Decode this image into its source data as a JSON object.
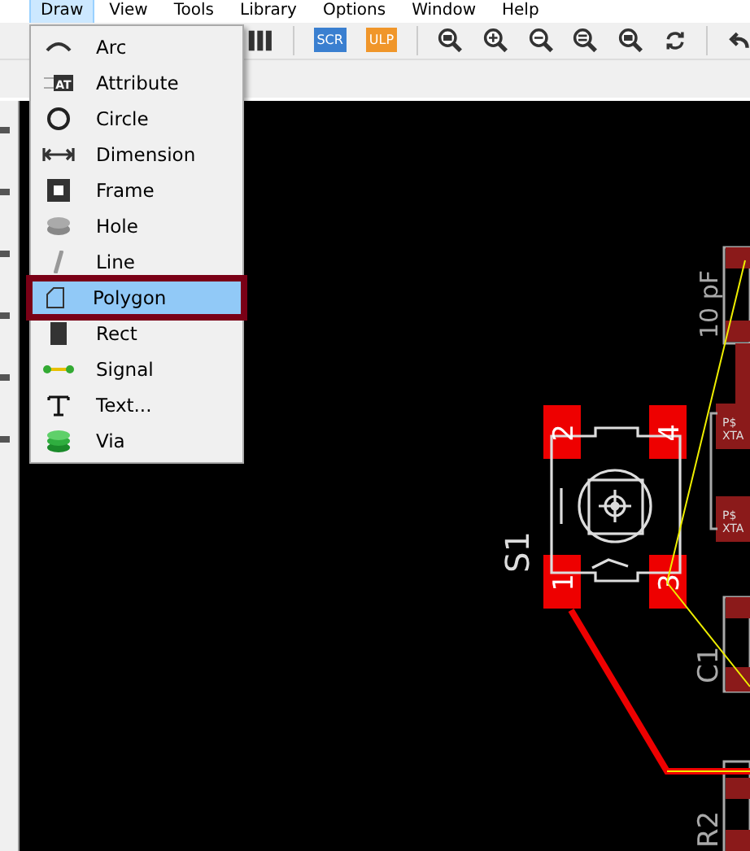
{
  "menubar": [
    {
      "label": "Draw",
      "selected": true
    },
    {
      "label": "View",
      "selected": false
    },
    {
      "label": "Tools",
      "selected": false
    },
    {
      "label": "Library",
      "selected": false
    },
    {
      "label": "Options",
      "selected": false
    },
    {
      "label": "Window",
      "selected": false
    },
    {
      "label": "Help",
      "selected": false
    }
  ],
  "toolbar": {
    "script_label": "SCR",
    "ulp_label": "ULP"
  },
  "draw_menu": [
    {
      "kind": "arc",
      "label": "Arc",
      "selected": false
    },
    {
      "kind": "attribute",
      "label": "Attribute",
      "icon_text": "AT",
      "selected": false
    },
    {
      "kind": "circle",
      "label": "Circle",
      "selected": false
    },
    {
      "kind": "dimension",
      "label": "Dimension",
      "selected": false
    },
    {
      "kind": "frame",
      "label": "Frame",
      "selected": false
    },
    {
      "kind": "hole",
      "label": "Hole",
      "selected": false
    },
    {
      "kind": "line",
      "label": "Line",
      "selected": false
    },
    {
      "kind": "polygon",
      "label": "Polygon",
      "selected": true
    },
    {
      "kind": "rect",
      "label": "Rect",
      "selected": false
    },
    {
      "kind": "signal",
      "label": "Signal",
      "selected": false
    },
    {
      "kind": "text",
      "label": "Text...",
      "selected": false
    },
    {
      "kind": "via",
      "label": "Via",
      "selected": false
    }
  ],
  "board": {
    "switch_name": "S1",
    "switch_pads": [
      "2",
      "1",
      "4",
      "3"
    ],
    "capacitor_top_value": "10 pF",
    "crystal_pads": [
      {
        "line_1": "P$",
        "line_2": "XTA"
      },
      {
        "line_1": "P$",
        "line_2": "XTA"
      }
    ],
    "capacitor_name": "C1",
    "resistor_name": "R2"
  }
}
